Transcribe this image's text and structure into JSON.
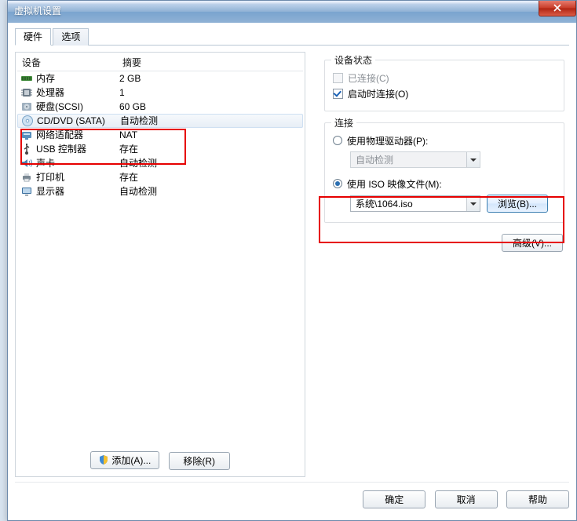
{
  "window": {
    "title": "虚拟机设置"
  },
  "tabs": {
    "hardware": "硬件",
    "options": "选项"
  },
  "hw_header": {
    "device": "设备",
    "summary": "摘要"
  },
  "hw": [
    {
      "icon": "memory",
      "name": "内存",
      "summary": "2 GB"
    },
    {
      "icon": "cpu",
      "name": "处理器",
      "summary": "1"
    },
    {
      "icon": "hdd",
      "name": "硬盘(SCSI)",
      "summary": "60 GB"
    },
    {
      "icon": "cd",
      "name": "CD/DVD (SATA)",
      "summary": "自动检测"
    },
    {
      "icon": "net",
      "name": "网络适配器",
      "summary": "NAT"
    },
    {
      "icon": "usb",
      "name": "USB 控制器",
      "summary": "存在"
    },
    {
      "icon": "sound",
      "name": "声卡",
      "summary": "自动检测"
    },
    {
      "icon": "printer",
      "name": "打印机",
      "summary": "存在"
    },
    {
      "icon": "display",
      "name": "显示器",
      "summary": "自动检测"
    }
  ],
  "left_buttons": {
    "add": "添加(A)...",
    "remove": "移除(R)"
  },
  "status": {
    "legend": "设备状态",
    "connected": "已连接(C)",
    "connect_on_start": "启动时连接(O)"
  },
  "connection": {
    "legend": "连接",
    "use_physical": "使用物理驱动器(P):",
    "physical_value": "自动检测",
    "use_iso": "使用 ISO 映像文件(M):",
    "iso_value": "系统\\1064.iso",
    "browse": "浏览(B)..."
  },
  "advanced": "高级(V)...",
  "footer": {
    "ok": "确定",
    "cancel": "取消",
    "help": "帮助"
  }
}
